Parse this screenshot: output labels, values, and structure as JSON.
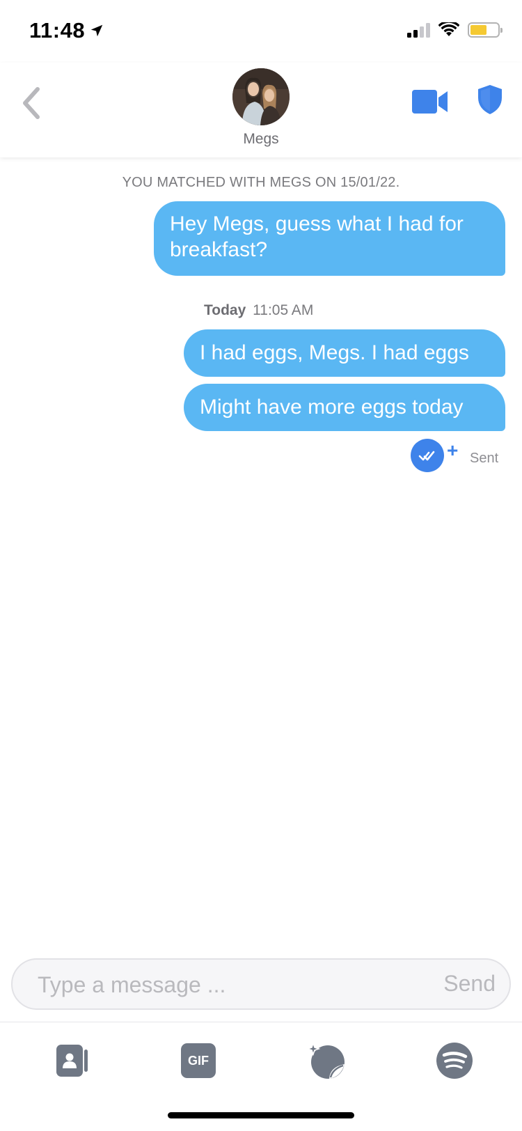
{
  "status_bar": {
    "time": "11:48",
    "location_icon": "location-arrow-icon",
    "signal_icon": "cellular-signal-icon",
    "wifi_icon": "wifi-icon",
    "battery_icon": "battery-icon",
    "battery_level": 0.6,
    "battery_color": "#f5c932"
  },
  "header": {
    "back_icon": "chevron-left-icon",
    "contact_name": "Megs",
    "video_icon": "video-camera-icon",
    "safety_icon": "shield-icon",
    "accent_color": "#3e83ea"
  },
  "chat": {
    "matched_text": "YOU MATCHED WITH MEGS ON 15/01/22.",
    "messages": [
      {
        "text": "Hey Megs, guess what I had for breakfast?",
        "sender": "me"
      },
      {
        "text": "I had eggs, Megs. I had eggs",
        "sender": "me"
      },
      {
        "text": "Might have more eggs today",
        "sender": "me"
      }
    ],
    "timestamp_day": "Today",
    "timestamp_time": "11:05 AM",
    "bubble_color": "#5ab7f3",
    "receipt_icon": "double-check-icon",
    "plus_label": "+",
    "status": "Sent"
  },
  "composer": {
    "placeholder": "Type a message ...",
    "value": "",
    "send_label": "Send"
  },
  "toolbar": {
    "items": [
      {
        "icon": "contact-card-icon"
      },
      {
        "icon": "gif-icon",
        "label": "GIF"
      },
      {
        "icon": "sticker-icon"
      },
      {
        "icon": "spotify-icon"
      }
    ]
  }
}
